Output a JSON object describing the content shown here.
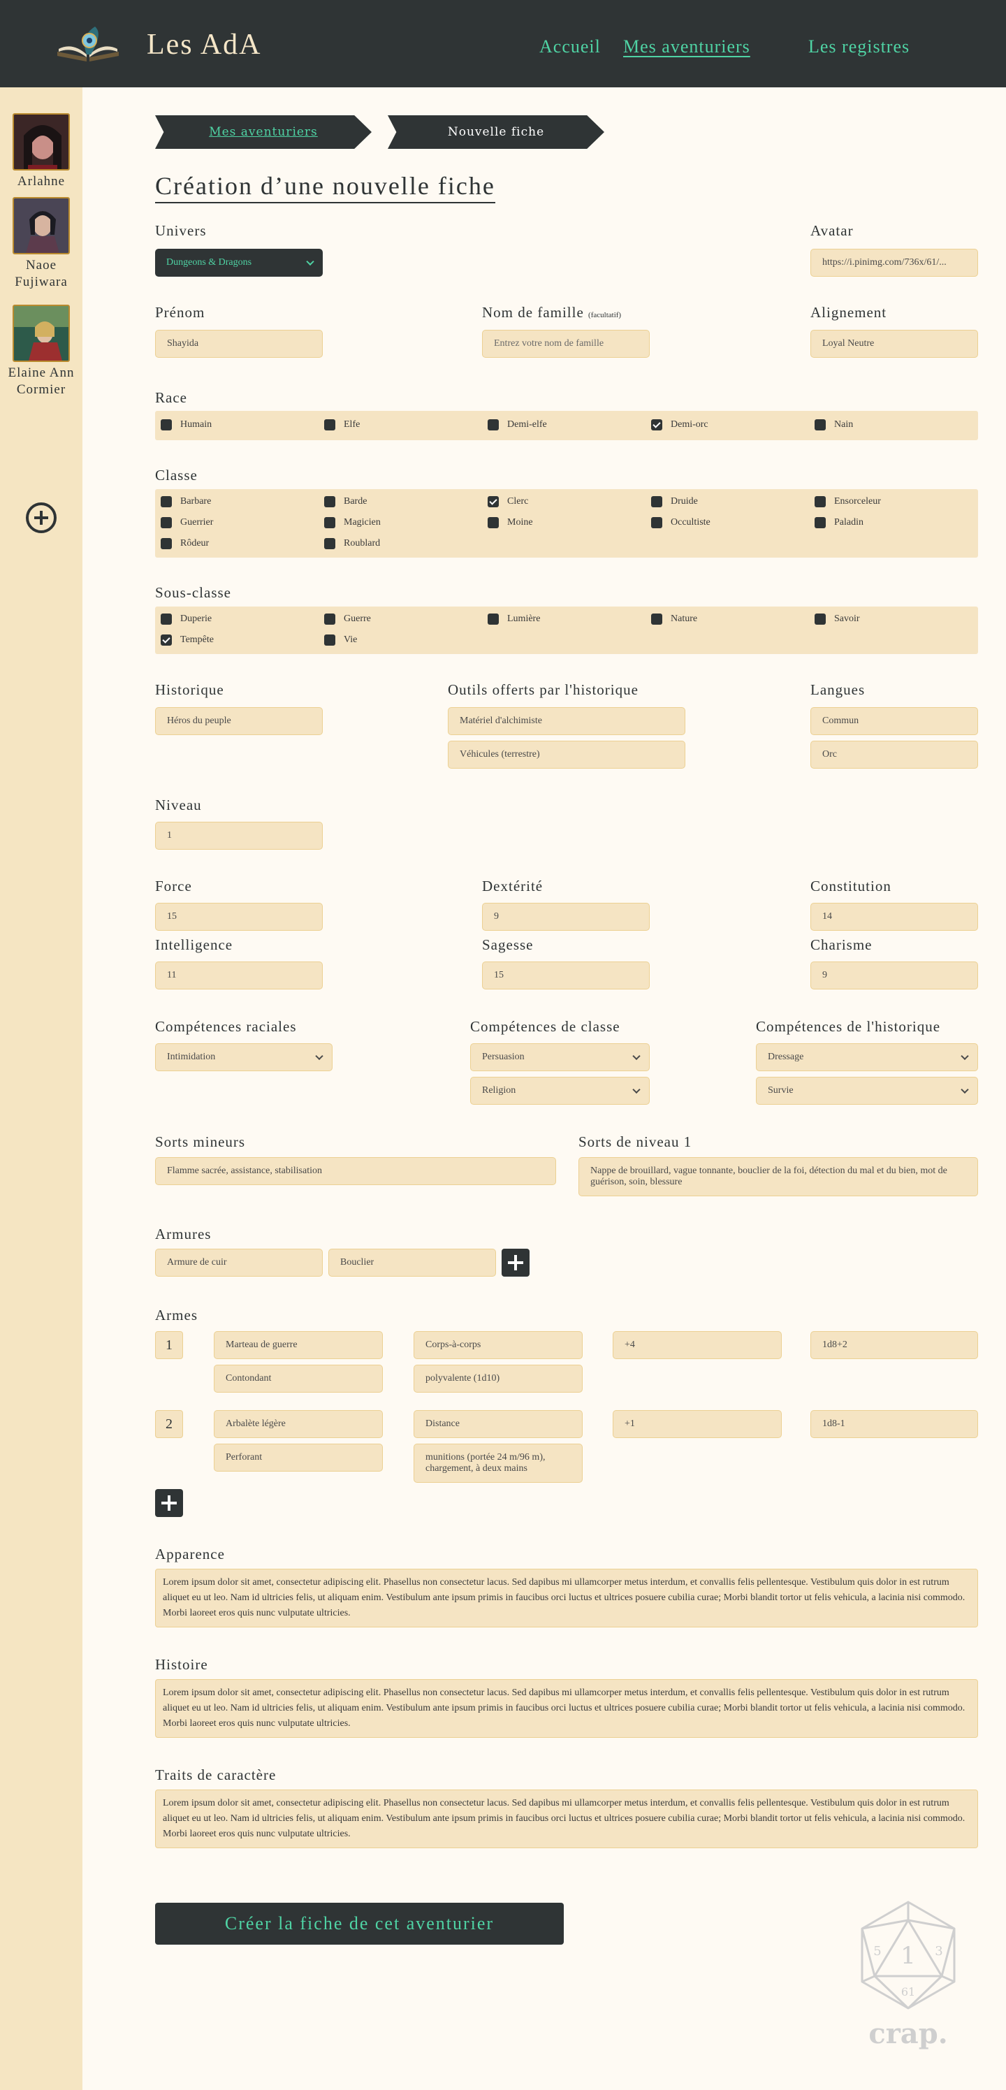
{
  "header": {
    "brand": "Les AdA",
    "nav": [
      "Accueil",
      "Mes aventuriers",
      "Les registres"
    ]
  },
  "sidebar": {
    "characters": [
      {
        "name": "Arlahne"
      },
      {
        "name": "Naoe Fujiwara"
      },
      {
        "name": "Elaine Ann Cormier"
      }
    ]
  },
  "breadcrumb": [
    "Mes aventuriers",
    "Nouvelle fiche"
  ],
  "title": "Création d’une nouvelle fiche",
  "univers": {
    "label": "Univers",
    "value": "Dungeons & Dragons"
  },
  "avatar": {
    "label": "Avatar",
    "value": "https://i.pinimg.com/736x/61/..."
  },
  "prenom": {
    "label": "Prénom",
    "value": "Shayida"
  },
  "nom": {
    "label": "Nom de famille",
    "hint": "(facultatif)",
    "placeholder": "Entrez votre nom de famille"
  },
  "alignement": {
    "label": "Alignement",
    "value": "Loyal Neutre"
  },
  "race": {
    "label": "Race",
    "options": [
      {
        "label": "Humain",
        "checked": false
      },
      {
        "label": "Elfe",
        "checked": false
      },
      {
        "label": "Demi-elfe",
        "checked": false
      },
      {
        "label": "Demi-orc",
        "checked": true
      },
      {
        "label": "Nain",
        "checked": false
      }
    ]
  },
  "classe": {
    "label": "Classe",
    "options": [
      {
        "label": "Barbare",
        "checked": false
      },
      {
        "label": "Barde",
        "checked": false
      },
      {
        "label": "Clerc",
        "checked": true
      },
      {
        "label": "Druide",
        "checked": false
      },
      {
        "label": "Ensorceleur",
        "checked": false
      },
      {
        "label": "Guerrier",
        "checked": false
      },
      {
        "label": "Magicien",
        "checked": false
      },
      {
        "label": "Moine",
        "checked": false
      },
      {
        "label": "Occultiste",
        "checked": false
      },
      {
        "label": "Paladin",
        "checked": false
      },
      {
        "label": "Rôdeur",
        "checked": false
      },
      {
        "label": "Roublard",
        "checked": false
      }
    ]
  },
  "sousclasse": {
    "label": "Sous-classe",
    "options": [
      {
        "label": "Duperie",
        "checked": false
      },
      {
        "label": "Guerre",
        "checked": false
      },
      {
        "label": "Lumière",
        "checked": false
      },
      {
        "label": "Nature",
        "checked": false
      },
      {
        "label": "Savoir",
        "checked": false
      },
      {
        "label": "Tempête",
        "checked": true
      },
      {
        "label": "Vie",
        "checked": false
      }
    ]
  },
  "historique": {
    "label": "Historique",
    "value": "Héros du peuple"
  },
  "outils": {
    "label": "Outils offerts par l'historique",
    "values": [
      "Matériel d'alchimiste",
      "Véhicules (terrestre)"
    ]
  },
  "langues": {
    "label": "Langues",
    "values": [
      "Commun",
      "Orc"
    ]
  },
  "niveau": {
    "label": "Niveau",
    "value": "1"
  },
  "stats": {
    "force": {
      "label": "Force",
      "value": "15"
    },
    "dexterite": {
      "label": "Dextérité",
      "value": "9"
    },
    "constitution": {
      "label": "Constitution",
      "value": "14"
    },
    "intelligence": {
      "label": "Intelligence",
      "value": "11"
    },
    "sagesse": {
      "label": "Sagesse",
      "value": "15"
    },
    "charisme": {
      "label": "Charisme",
      "value": "9"
    }
  },
  "competences": {
    "raciales": {
      "label": "Compétences raciales",
      "values": [
        "Intimidation"
      ]
    },
    "classe": {
      "label": "Compétences de classe",
      "values": [
        "Persuasion",
        "Religion"
      ]
    },
    "historique": {
      "label": "Compétences de l'historique",
      "values": [
        "Dressage",
        "Survie"
      ]
    }
  },
  "sorts": {
    "mineurs": {
      "label": "Sorts mineurs",
      "value": "Flamme sacrée, assistance, stabilisation"
    },
    "niveau1": {
      "label": "Sorts de niveau 1",
      "value": "Nappe de brouillard, vague tonnante, bouclier de la foi, détection du mal et du bien, mot de guérison, soin, blessure"
    }
  },
  "armures": {
    "label": "Armures",
    "values": [
      "Armure de cuir",
      "Bouclier"
    ]
  },
  "armes": {
    "label": "Armes",
    "items": [
      {
        "num": "1",
        "name": "Marteau de guerre",
        "type": "Corps-à-corps",
        "bonus": "+4",
        "damage": "1d8+2",
        "dmg_type": "Contondant",
        "props": "polyvalente (1d10)"
      },
      {
        "num": "2",
        "name": "Arbalète légère",
        "type": "Distance",
        "bonus": "+1",
        "damage": "1d8-1",
        "dmg_type": "Perforant",
        "props": "munitions (portée 24 m/96 m), chargement, à deux mains"
      }
    ]
  },
  "apparence": {
    "label": "Apparence",
    "value": "Lorem ipsum dolor sit amet, consectetur adipiscing elit. Phasellus non  consectetur lacus. Sed dapibus mi ullamcorper metus interdum, et  convallis felis pellentesque. Vestibulum quis dolor in est rutrum  aliquet eu ut leo. Nam id ultricies felis, ut aliquam enim. Vestibulum  ante ipsum primis in faucibus orci luctus et ultrices posuere cubilia  curae; Morbi blandit tortor ut felis vehicula, a lacinia nisi commodo.  Morbi laoreet eros quis nunc vulputate ultricies."
  },
  "histoire": {
    "label": "Histoire",
    "value": "Lorem ipsum dolor sit amet, consectetur adipiscing elit. Phasellus non  consectetur lacus. Sed dapibus mi ullamcorper metus interdum, et  convallis felis pellentesque. Vestibulum quis dolor in est rutrum  aliquet eu ut leo. Nam id ultricies felis, ut aliquam enim. Vestibulum  ante ipsum primis in faucibus orci luctus et ultrices posuere cubilia  curae; Morbi blandit tortor ut felis vehicula, a lacinia nisi commodo.  Morbi laoreet eros quis nunc vulputate ultricies."
  },
  "traits": {
    "label": "Traits de caractère",
    "value": "Lorem ipsum dolor sit amet, consectetur adipiscing elit. Phasellus non  consectetur lacus. Sed dapibus mi ullamcorper metus interdum, et  convallis felis pellentesque. Vestibulum quis dolor in est rutrum  aliquet eu ut leo. Nam id ultricies felis, ut aliquam enim. Vestibulum  ante ipsum primis in faucibus orci luctus et ultrices posuere cubilia  curae; Morbi blandit tortor ut felis vehicula, a lacinia nisi commodo.  Morbi laoreet eros quis nunc vulputate ultricies."
  },
  "submit": "Créer la fiche de cet aventurier",
  "watermark": {
    "dice_numbers": [
      "1",
      "5",
      "3",
      "61"
    ],
    "text": "crap."
  },
  "colors": {
    "dark": "#2f3435",
    "accent": "#4fd3a4",
    "field": "#f5e4c3",
    "sidebar": "#f5e5c2",
    "page": "#fefaf3"
  }
}
